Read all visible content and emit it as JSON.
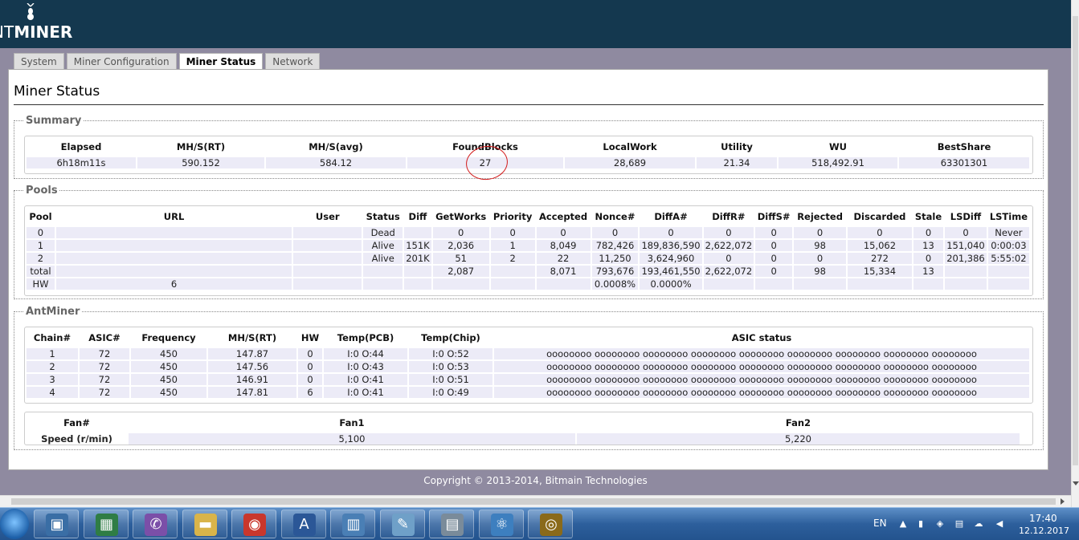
{
  "header": {
    "logo_text_thin": "NT",
    "logo_text_bold": "MINER"
  },
  "tabs": [
    {
      "label": "System"
    },
    {
      "label": "Miner Configuration"
    },
    {
      "label": "Miner Status"
    },
    {
      "label": "Network"
    }
  ],
  "page_title": "Miner Status",
  "summary": {
    "legend": "Summary",
    "headers": [
      "Elapsed",
      "MH/S(RT)",
      "MH/S(avg)",
      "FoundBlocks",
      "LocalWork",
      "Utility",
      "WU",
      "BestShare"
    ],
    "row": [
      "6h18m11s",
      "590.152",
      "584.12",
      "27",
      "28,689",
      "21.34",
      "518,492.91",
      "63301301"
    ]
  },
  "pools": {
    "legend": "Pools",
    "headers": [
      "Pool",
      "URL",
      "User",
      "Status",
      "Diff",
      "GetWorks",
      "Priority",
      "Accepted",
      "Nonce#",
      "DiffA#",
      "DiffR#",
      "DiffS#",
      "Rejected",
      "Discarded",
      "Stale",
      "LSDiff",
      "LSTime"
    ],
    "rows": [
      [
        "0",
        "",
        "",
        "Dead",
        "",
        "0",
        "0",
        "0",
        "0",
        "0",
        "0",
        "0",
        "0",
        "0",
        "0",
        "0",
        "Never"
      ],
      [
        "1",
        "",
        "",
        "Alive",
        "151K",
        "2,036",
        "1",
        "8,049",
        "782,426",
        "189,836,590",
        "2,622,072",
        "0",
        "98",
        "15,062",
        "13",
        "151,040",
        "0:00:03"
      ],
      [
        "2",
        "",
        "",
        "Alive",
        "201K",
        "51",
        "2",
        "22",
        "11,250",
        "3,624,960",
        "0",
        "0",
        "0",
        "272",
        "0",
        "201,386",
        "5:55:02"
      ],
      [
        "total",
        "",
        "",
        "",
        "",
        "2,087",
        "",
        "8,071",
        "793,676",
        "193,461,550",
        "2,622,072",
        "0",
        "98",
        "15,334",
        "13",
        "",
        ""
      ],
      [
        "HW",
        "6",
        "",
        "",
        "",
        "",
        "",
        "",
        "0.0008%",
        "0.0000%",
        "",
        "",
        "",
        "",
        "",
        "",
        ""
      ]
    ]
  },
  "antminer": {
    "legend": "AntMiner",
    "headers": [
      "Chain#",
      "ASIC#",
      "Frequency",
      "MH/S(RT)",
      "HW",
      "Temp(PCB)",
      "Temp(Chip)",
      "ASIC status"
    ],
    "rows": [
      [
        "1",
        "72",
        "450",
        "147.87",
        "0",
        "I:0 O:44",
        "I:0 O:52",
        "oooooooo oooooooo oooooooo oooooooo oooooooo oooooooo oooooooo oooooooo oooooooo"
      ],
      [
        "2",
        "72",
        "450",
        "147.56",
        "0",
        "I:0 O:43",
        "I:0 O:53",
        "oooooooo oooooooo oooooooo oooooooo oooooooo oooooooo oooooooo oooooooo oooooooo"
      ],
      [
        "3",
        "72",
        "450",
        "146.91",
        "0",
        "I:0 O:41",
        "I:0 O:51",
        "oooooooo oooooooo oooooooo oooooooo oooooooo oooooooo oooooooo oooooooo oooooooo"
      ],
      [
        "4",
        "72",
        "450",
        "147.81",
        "6",
        "I:0 O:41",
        "I:0 O:49",
        "oooooooo oooooooo oooooooo oooooooo oooooooo oooooooo oooooooo oooooooo oooooooo"
      ]
    ],
    "fan_headers": [
      "Fan#",
      "Fan1",
      "Fan2"
    ],
    "fan_row": [
      "Speed (r/min)",
      "5,100",
      "5,220"
    ]
  },
  "footer": {
    "copyright": "Copyright © 2013-2014, Bitmain Technologies"
  },
  "taskbar": {
    "apps": [
      "computer-icon",
      "task-manager-icon",
      "viber-icon",
      "folder-icon",
      "chrome-icon",
      "word-icon",
      "control-panel-icon",
      "notepad-icon",
      "calculator-icon",
      "atom-icon",
      "coin-app-icon"
    ],
    "lang": "EN",
    "time": "17:40",
    "date": "12.12.2017"
  },
  "colors": {
    "header_bg": "#14384f",
    "cell_bg": "#ecebf7",
    "annotation": "#d21a1a"
  }
}
